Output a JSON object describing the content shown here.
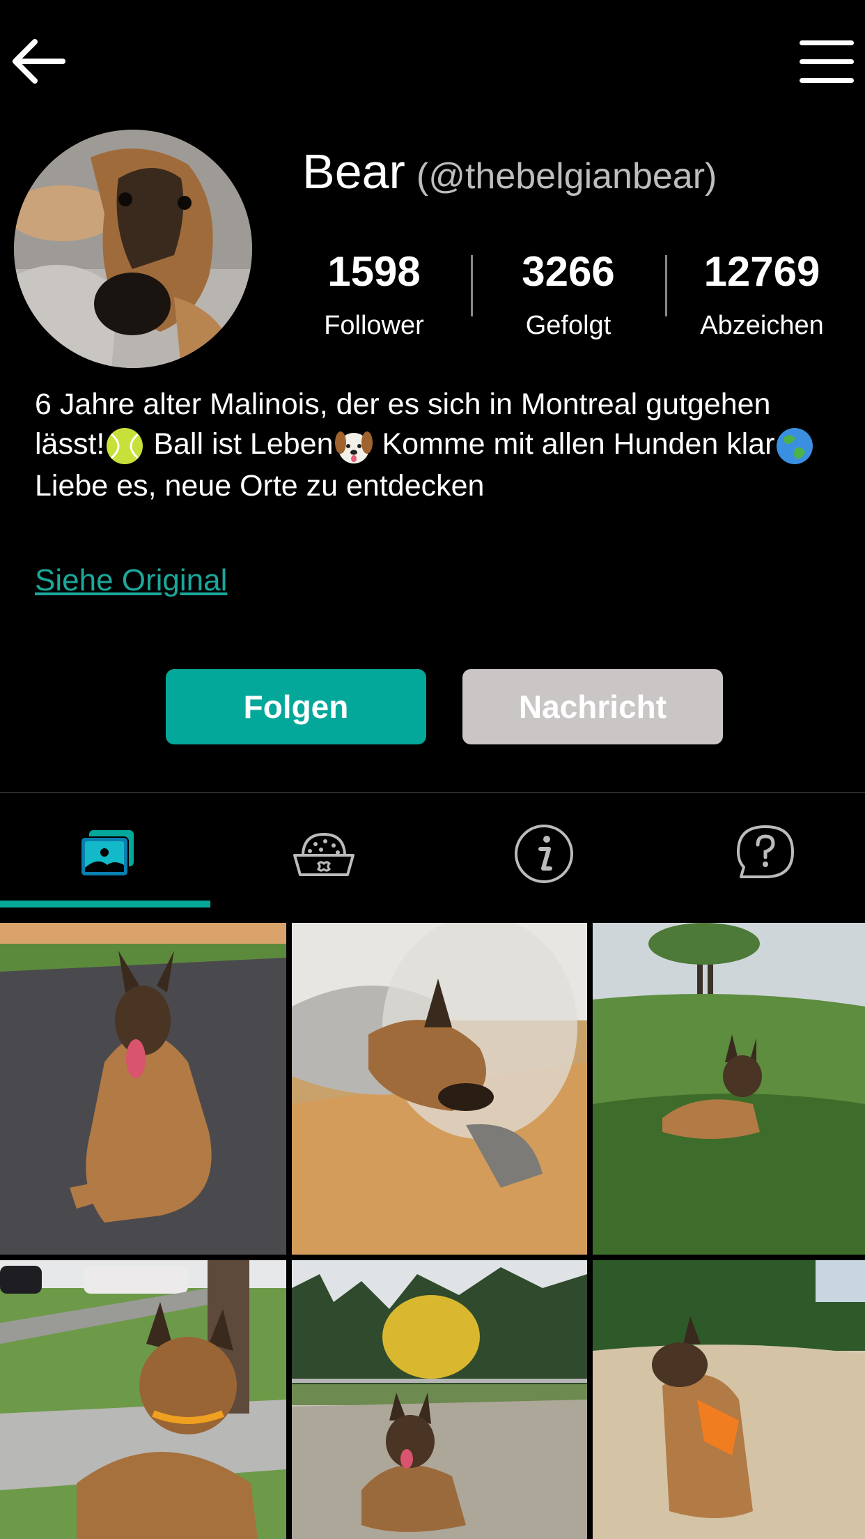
{
  "header": {
    "back_icon": "arrow-left-icon",
    "menu_icon": "hamburger-menu-icon"
  },
  "profile": {
    "name": "Bear",
    "handle": "(@thebelgianbear)",
    "stats": [
      {
        "value": "1598",
        "label": "Follower"
      },
      {
        "value": "3266",
        "label": "Gefolgt"
      },
      {
        "value": "12769",
        "label": "Abzeichen"
      }
    ],
    "bio": {
      "part1": " 6 Jahre alter Malinois, der es sich in Montreal gutgehen lässt!",
      "part2": " Ball ist Leben",
      "part3": " Komme mit allen Hunden klar",
      "part4": " Liebe es, neue Orte zu entdecken"
    },
    "see_original": "Siehe Original"
  },
  "actions": {
    "follow": "Folgen",
    "message": "Nachricht"
  },
  "tabs": [
    {
      "icon": "photos-icon",
      "active": true
    },
    {
      "icon": "food-bowl-icon",
      "active": false
    },
    {
      "icon": "info-icon",
      "active": false
    },
    {
      "icon": "question-chat-icon",
      "active": false
    }
  ],
  "colors": {
    "accent": "#04a89a",
    "link": "#1aa89a",
    "message_button": "#cac6c6",
    "background": "#000000"
  }
}
